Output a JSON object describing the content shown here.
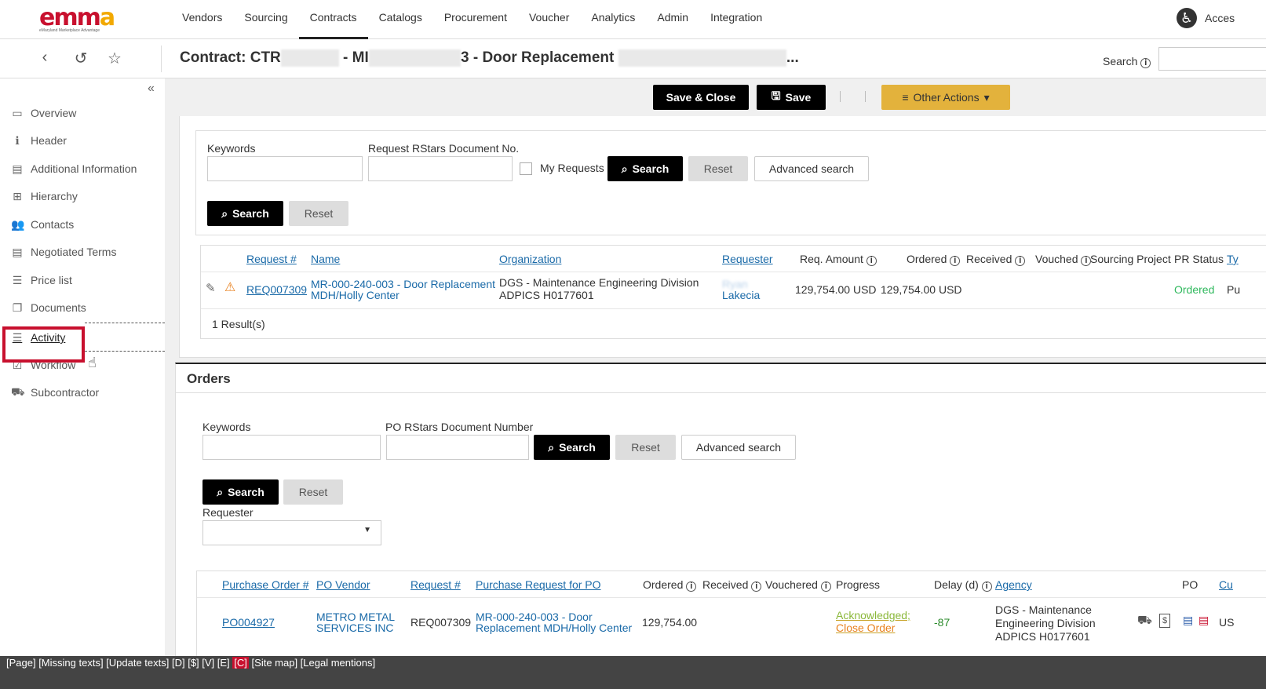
{
  "logo": {
    "text": "emma",
    "sub": "eMaryland Marketplace Advantage"
  },
  "nav": {
    "items": [
      "Vendors",
      "Sourcing",
      "Contracts",
      "Catalogs",
      "Procurement",
      "Voucher",
      "Analytics",
      "Admin",
      "Integration"
    ],
    "active": "Contracts"
  },
  "accessibility_label": "Acces",
  "titlebar": {
    "title_prefix": "Contract: CTR",
    "title_mid": " - MI",
    "title_suffix": "3 - Door Replacement",
    "title_end": "...",
    "search_label": "Search"
  },
  "sidebar": {
    "items": [
      {
        "icon": "monitor-icon",
        "label": "Overview"
      },
      {
        "icon": "info-icon",
        "label": "Header"
      },
      {
        "icon": "document-icon",
        "label": "Additional Information"
      },
      {
        "icon": "hierarchy-icon",
        "label": "Hierarchy"
      },
      {
        "icon": "contacts-icon",
        "label": "Contacts"
      },
      {
        "icon": "document-icon",
        "label": "Negotiated Terms"
      },
      {
        "icon": "list-icon",
        "label": "Price list"
      },
      {
        "icon": "documents-icon",
        "label": "Documents"
      },
      {
        "icon": "activity-icon",
        "label": "Activity"
      },
      {
        "icon": "checkbox-icon",
        "label": "Workflow"
      },
      {
        "icon": "truck-icon",
        "label": "Subcontractor"
      }
    ],
    "active": "Activity"
  },
  "actions": {
    "save_close": "Save & Close",
    "save": "Save",
    "other": "Other Actions"
  },
  "requests": {
    "keywords_label": "Keywords",
    "docno_label": "Request RStars Document No.",
    "my_requests": "My Requests",
    "search": "Search",
    "reset": "Reset",
    "advanced": "Advanced search",
    "columns": [
      "Request #",
      "Name",
      "Organization",
      "Requester",
      "Req. Amount",
      "Ordered",
      "Received",
      "Vouched",
      "Sourcing Project",
      "PR Status",
      "Ty"
    ],
    "row": {
      "request_no": "REQ007309",
      "name_1": "MR-000-240-003 - Door Replacement",
      "name_2": "MDH/Holly Center",
      "org_1": "DGS - Maintenance Engineering Division",
      "org_2": "ADPICS H0177601",
      "requester": "Lakecia",
      "req_amount": "129,754.00 USD",
      "ordered": "129,754.00 USD",
      "pr_status": "Ordered",
      "type": "Pu"
    },
    "results": "1 Result(s)"
  },
  "orders": {
    "title": "Orders",
    "keywords_label": "Keywords",
    "docno_label": "PO RStars Document Number",
    "search": "Search",
    "reset": "Reset",
    "advanced": "Advanced search",
    "requester_label": "Requester",
    "columns": [
      "Purchase Order #",
      "PO Vendor",
      "Request #",
      "Purchase Request for PO",
      "Ordered",
      "Received",
      "Vouchered",
      "Progress",
      "Delay (d)",
      "Agency",
      "PO",
      "Cu"
    ],
    "row": {
      "po_no": "PO004927",
      "vendor_1": "METRO METAL",
      "vendor_2": "SERVICES INC",
      "request_no": "REQ007309",
      "pr_1": "MR-000-240-003 - Door",
      "pr_2": "Replacement MDH/Holly Center",
      "ordered": "129,754.00",
      "progress_1": "Acknowledged;",
      "progress_2": "Close Order",
      "delay": "-87",
      "agency_1": "DGS - Maintenance",
      "agency_2": "Engineering Division",
      "agency_3": "ADPICS H0177601",
      "cur": "US"
    }
  },
  "footer": {
    "pre": "[Page] [Missing texts] [Update texts] [D] [$] [V] [E] ",
    "c": "[C]",
    "post": " [Site map] [Legal mentions]"
  },
  "colors": {
    "accent": "#e3b23c",
    "brand_red": "#c8102e",
    "link": "#1a6aa8",
    "status_green": "#2eb85c"
  }
}
